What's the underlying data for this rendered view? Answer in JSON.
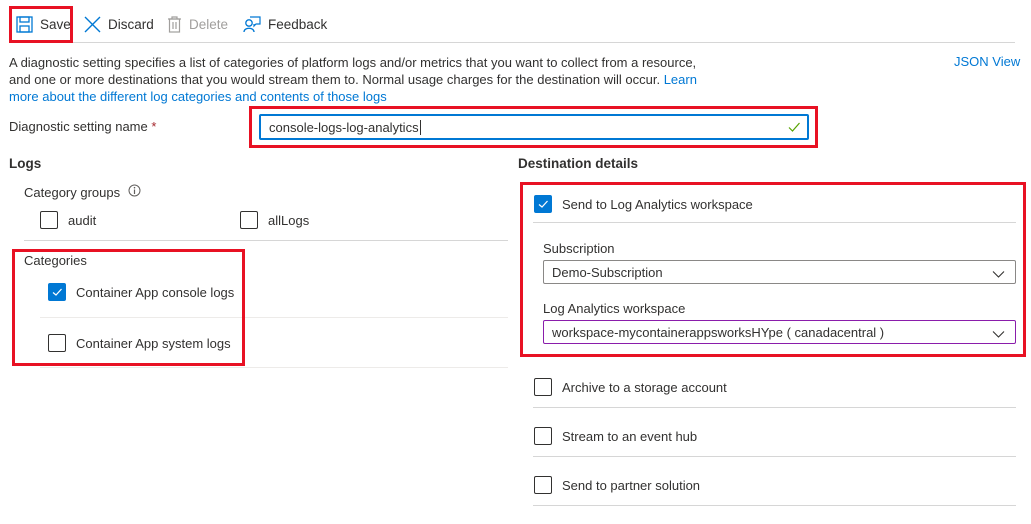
{
  "toolbar": {
    "save": "Save",
    "discard": "Discard",
    "delete": "Delete",
    "feedback": "Feedback"
  },
  "description": {
    "text": "A diagnostic setting specifies a list of categories of platform logs and/or metrics that you want to collect from a resource, and one or more destinations that you would stream them to. Normal usage charges for the destination will occur. ",
    "link": "Learn more about the different log categories and contents of those logs"
  },
  "json_view": "JSON View",
  "setting_name": {
    "label": "Diagnostic setting name",
    "required_marker": "*",
    "value": "console-logs-log-analytics",
    "valid": true
  },
  "logs": {
    "title": "Logs",
    "category_groups_label": "Category groups",
    "category_groups": [
      {
        "label": "audit",
        "checked": false
      },
      {
        "label": "allLogs",
        "checked": false
      }
    ],
    "categories_label": "Categories",
    "categories": [
      {
        "label": "Container App console logs",
        "checked": true
      },
      {
        "label": "Container App system logs",
        "checked": false
      }
    ]
  },
  "destination": {
    "title": "Destination details",
    "log_analytics": {
      "label": "Send to Log Analytics workspace",
      "checked": true
    },
    "subscription": {
      "label": "Subscription",
      "value": "Demo-Subscription"
    },
    "workspace": {
      "label": "Log Analytics workspace",
      "value": "workspace-mycontainerappsworksHYpe ( canadacentral )"
    },
    "others": [
      {
        "label": "Archive to a storage account",
        "checked": false
      },
      {
        "label": "Stream to an event hub",
        "checked": false
      },
      {
        "label": "Send to partner solution",
        "checked": false
      }
    ]
  },
  "colors": {
    "accent": "#0078d4",
    "highlight": "#e81123",
    "focus_border": "#8a1dab",
    "valid_check": "#57a300"
  }
}
